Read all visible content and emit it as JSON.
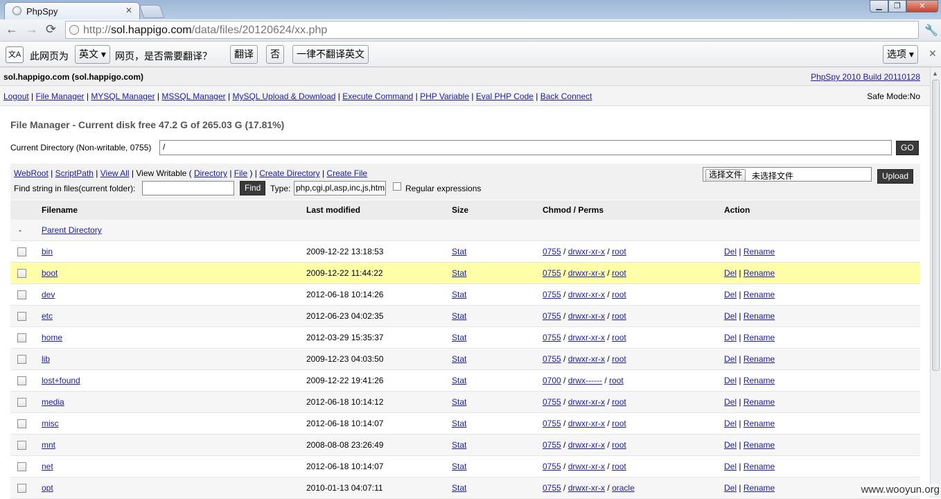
{
  "browser": {
    "tab_title": "PhpSpy",
    "url_prefix": "http://",
    "url_host": "sol.happigo.com",
    "url_path": "/data/files/20120624/xx.php"
  },
  "translate_bar": {
    "prefix": "此网页为",
    "language": "英文",
    "question": "网页，是否需要翻译？",
    "translate": "翻译",
    "no": "否",
    "never": "一律不翻译英文",
    "options": "选项"
  },
  "header": {
    "host": "sol.happigo.com (sol.happigo.com)",
    "brand": "PhpSpy 2010 Build 20110128",
    "safe_mode": "Safe Mode:No",
    "menu": [
      "Logout",
      "File Manager",
      "MYSQL Manager",
      "MSSQL Manager",
      "MySQL Upload & Download",
      "Execute Command",
      "PHP Variable",
      "Eval PHP Code",
      "Back Connect"
    ]
  },
  "file_manager": {
    "title": "File Manager - Current disk free 47.2 G of 265.03 G (17.81%)",
    "current_dir_label": "Current Directory (Non-writable, 0755)",
    "current_dir_value": "/",
    "go_label": "GO",
    "links": {
      "webroot": "WebRoot",
      "scriptpath": "ScriptPath",
      "viewall": "View All",
      "viewwritable": "View Writable (",
      "directory": "Directory",
      "file": "File",
      "close_paren": ")",
      "createdir": "Create Directory",
      "createfile": "Create File"
    },
    "find_label": "Find string in files(current folder):",
    "find_button": "Find",
    "type_label": "Type:",
    "type_value": "php,cgi,pl,asp,inc,js,html",
    "regex_label": "Regular expressions",
    "choose_file": "选择文件",
    "no_file": "未选择文件",
    "upload": "Upload"
  },
  "table": {
    "columns": [
      "Filename",
      "Last modified",
      "Size",
      "Chmod / Perms",
      "Action"
    ],
    "parent_dash": "-",
    "parent_label": "Parent Directory",
    "rows": [
      {
        "name": "bin",
        "modified": "2009-12-22 13:18:53",
        "size": "Stat",
        "chmod": "0755",
        "perms": "drwxr-xr-x",
        "owner": "root",
        "del": "Del",
        "rename": "Rename"
      },
      {
        "name": "boot",
        "modified": "2009-12-22 11:44:22",
        "size": "Stat",
        "chmod": "0755",
        "perms": "drwxr-xr-x",
        "owner": "root",
        "del": "Del",
        "rename": "Rename"
      },
      {
        "name": "dev",
        "modified": "2012-06-18 10:14:26",
        "size": "Stat",
        "chmod": "0755",
        "perms": "drwxr-xr-x",
        "owner": "root",
        "del": "Del",
        "rename": "Rename"
      },
      {
        "name": "etc",
        "modified": "2012-06-23 04:02:35",
        "size": "Stat",
        "chmod": "0755",
        "perms": "drwxr-xr-x",
        "owner": "root",
        "del": "Del",
        "rename": "Rename"
      },
      {
        "name": "home",
        "modified": "2012-03-29 15:35:37",
        "size": "Stat",
        "chmod": "0755",
        "perms": "drwxr-xr-x",
        "owner": "root",
        "del": "Del",
        "rename": "Rename"
      },
      {
        "name": "lib",
        "modified": "2009-12-23 04:03:50",
        "size": "Stat",
        "chmod": "0755",
        "perms": "drwxr-xr-x",
        "owner": "root",
        "del": "Del",
        "rename": "Rename"
      },
      {
        "name": "lost+found",
        "modified": "2009-12-22 19:41:26",
        "size": "Stat",
        "chmod": "0700",
        "perms": "drwx------",
        "owner": "root",
        "del": "Del",
        "rename": "Rename"
      },
      {
        "name": "media",
        "modified": "2012-06-18 10:14:12",
        "size": "Stat",
        "chmod": "0755",
        "perms": "drwxr-xr-x",
        "owner": "root",
        "del": "Del",
        "rename": "Rename"
      },
      {
        "name": "misc",
        "modified": "2012-06-18 10:14:07",
        "size": "Stat",
        "chmod": "0755",
        "perms": "drwxr-xr-x",
        "owner": "root",
        "del": "Del",
        "rename": "Rename"
      },
      {
        "name": "mnt",
        "modified": "2008-08-08 23:26:49",
        "size": "Stat",
        "chmod": "0755",
        "perms": "drwxr-xr-x",
        "owner": "root",
        "del": "Del",
        "rename": "Rename"
      },
      {
        "name": "net",
        "modified": "2012-06-18 10:14:07",
        "size": "Stat",
        "chmod": "0755",
        "perms": "drwxr-xr-x",
        "owner": "root",
        "del": "Del",
        "rename": "Rename"
      },
      {
        "name": "opt",
        "modified": "2010-01-13 04:07:11",
        "size": "Stat",
        "chmod": "0755",
        "perms": "drwxr-xr-x",
        "owner": "oracle",
        "del": "Del",
        "rename": "Rename"
      }
    ]
  },
  "watermark": "www.wooyun.org"
}
